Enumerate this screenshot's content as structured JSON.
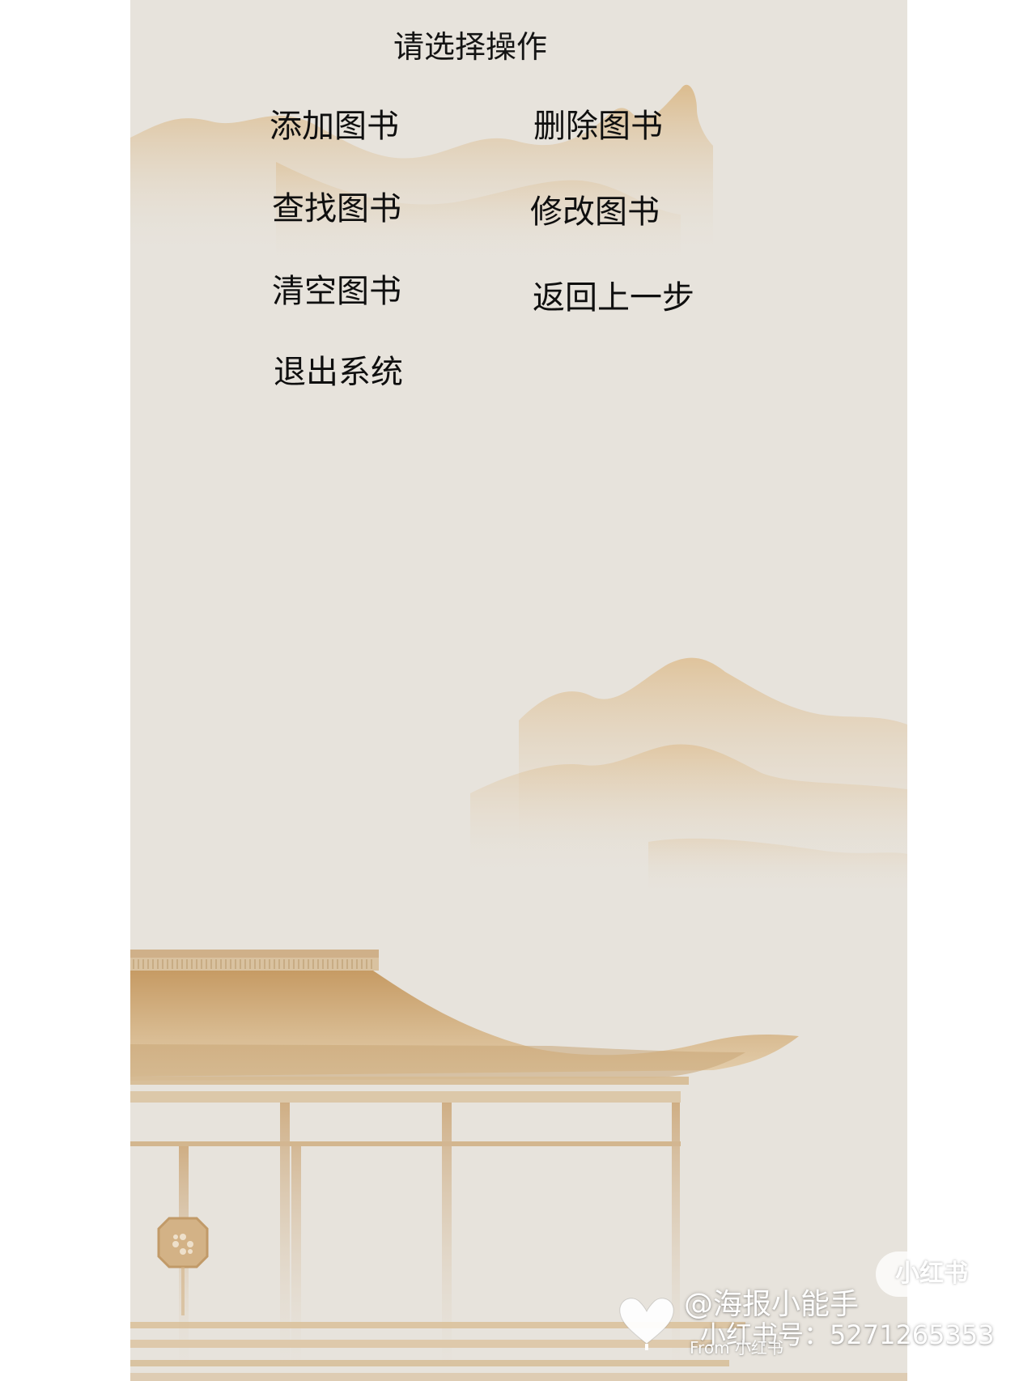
{
  "menu": {
    "title": "请选择操作",
    "buttons": {
      "add": "添加图书",
      "delete": "删除图书",
      "find": "查找图书",
      "modify": "修改图书",
      "clear": "清空图书",
      "back": "返回上一步",
      "exit": "退出系统"
    }
  },
  "watermark": {
    "logo": "小红书",
    "user": "@海报小能手",
    "id": "小红书号：5271265353",
    "from": "From 小红书"
  },
  "colors": {
    "background": "#e7e3dc",
    "mountain": "#d9b47c",
    "roof": "#c9a06c",
    "text": "#141414"
  }
}
